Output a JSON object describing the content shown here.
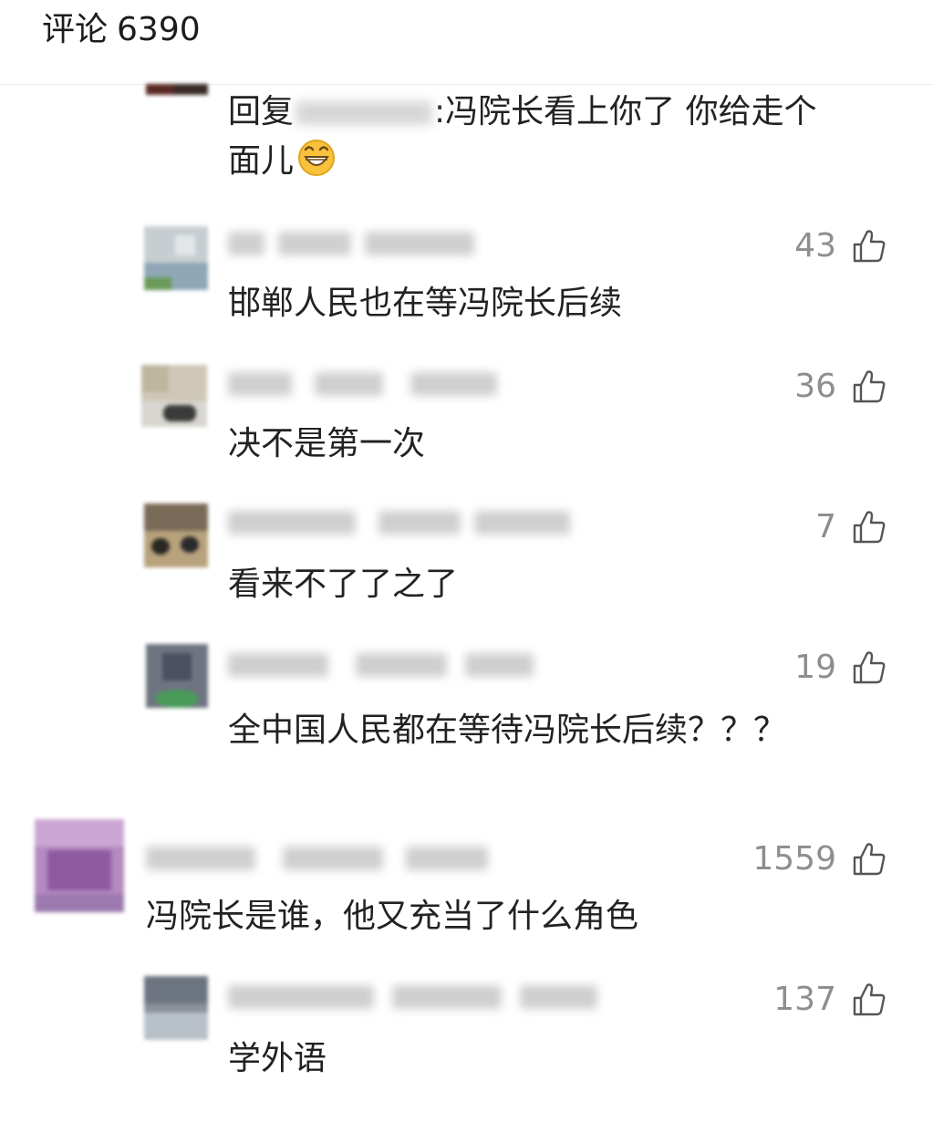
{
  "header": {
    "title": "评论",
    "count": "6390"
  },
  "comments": [
    {
      "kind": "reply",
      "reply_prefix": "回复",
      "text_line1": ":冯院长看上你了 你给走个",
      "text_line2": "面儿",
      "emoji": "grinning-face-icon"
    },
    {
      "kind": "reply",
      "likes": "43",
      "text": "邯郸人民也在等冯院长后续"
    },
    {
      "kind": "reply",
      "likes": "36",
      "text": "决不是第一次"
    },
    {
      "kind": "reply",
      "likes": "7",
      "text": "看来不了了之了"
    },
    {
      "kind": "reply",
      "likes": "19",
      "text": "全中国人民都在等待冯院长后续？？？"
    },
    {
      "kind": "top",
      "likes": "1559",
      "text": "冯院长是谁，他又充当了什么角色"
    },
    {
      "kind": "reply",
      "likes": "137",
      "text": "学外语"
    }
  ],
  "icons": {
    "like": "thumbs-up-icon",
    "emoji": "grinning-face-icon"
  },
  "colors": {
    "text": "#222222",
    "like_count": "#8e8e8e",
    "divider": "#ececec"
  }
}
